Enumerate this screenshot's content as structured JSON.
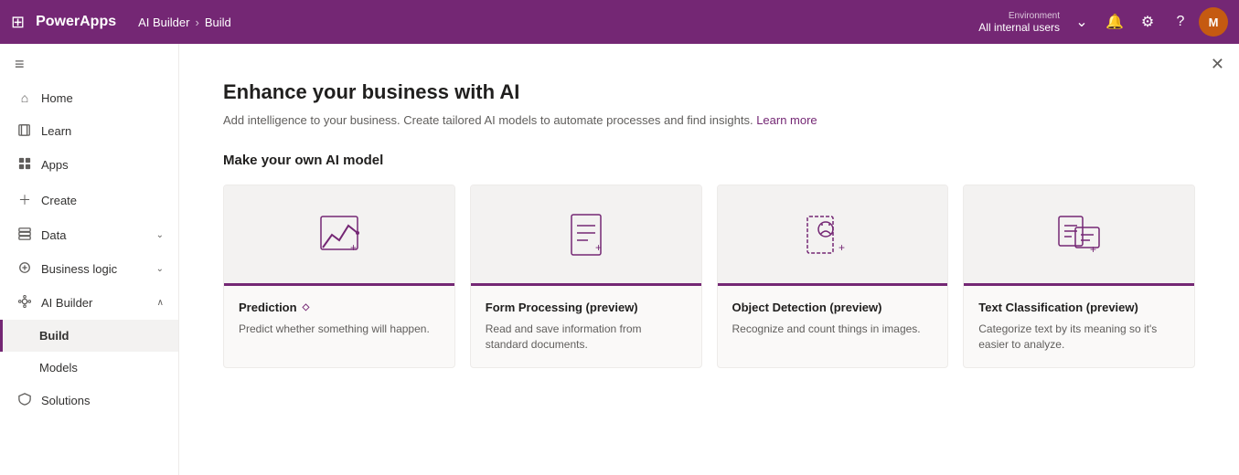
{
  "topbar": {
    "waffle_icon": "⊞",
    "brand": "PowerApps",
    "breadcrumb": [
      "AI Builder",
      "Build"
    ],
    "breadcrumb_separator": ">",
    "env_label": "Environment",
    "env_value": "All internal users",
    "chevron": "⌄"
  },
  "sidebar": {
    "collapse_icon": "≡",
    "items": [
      {
        "id": "home",
        "label": "Home",
        "icon": "⌂",
        "active": false
      },
      {
        "id": "learn",
        "label": "Learn",
        "icon": "◫",
        "active": false
      },
      {
        "id": "apps",
        "label": "Apps",
        "icon": "⊡",
        "active": false
      },
      {
        "id": "create",
        "label": "Create",
        "icon": "+",
        "active": false
      },
      {
        "id": "data",
        "label": "Data",
        "icon": "⊞",
        "active": false,
        "chevron": "⌄"
      },
      {
        "id": "business-logic",
        "label": "Business logic",
        "icon": "⊙",
        "active": false,
        "chevron": "⌄"
      },
      {
        "id": "ai-builder",
        "label": "AI Builder",
        "icon": "⊗",
        "active": true,
        "chevron": "∧"
      },
      {
        "id": "build",
        "label": "Build",
        "sub": true,
        "active": true
      },
      {
        "id": "models",
        "label": "Models",
        "sub": true,
        "active": false
      },
      {
        "id": "solutions",
        "label": "Solutions",
        "icon": "◈",
        "active": false
      }
    ]
  },
  "content": {
    "close_icon": "✕",
    "title": "Enhance your business with AI",
    "subtitle": "Add intelligence to your business. Create tailored AI models to automate processes and find insights.",
    "learn_more_label": "Learn more",
    "section_title": "Make your own AI model",
    "cards": [
      {
        "id": "prediction",
        "title": "Prediction",
        "badge": "◇",
        "description": "Predict whether something will happen.",
        "icon_type": "prediction"
      },
      {
        "id": "form-processing",
        "title": "Form Processing (preview)",
        "badge": "",
        "description": "Read and save information from standard documents.",
        "icon_type": "form"
      },
      {
        "id": "object-detection",
        "title": "Object Detection (preview)",
        "badge": "",
        "description": "Recognize and count things in images.",
        "icon_type": "object"
      },
      {
        "id": "text-classification",
        "title": "Text Classification (preview)",
        "badge": "",
        "description": "Categorize text by its meaning so it's easier to analyze.",
        "icon_type": "text"
      }
    ]
  },
  "icons": {
    "home": "🏠",
    "learn": "📖",
    "apps": "📱",
    "create": "+",
    "data": "📊",
    "business_logic": "⚙",
    "ai_builder": "🤖",
    "solutions": "🔷"
  }
}
